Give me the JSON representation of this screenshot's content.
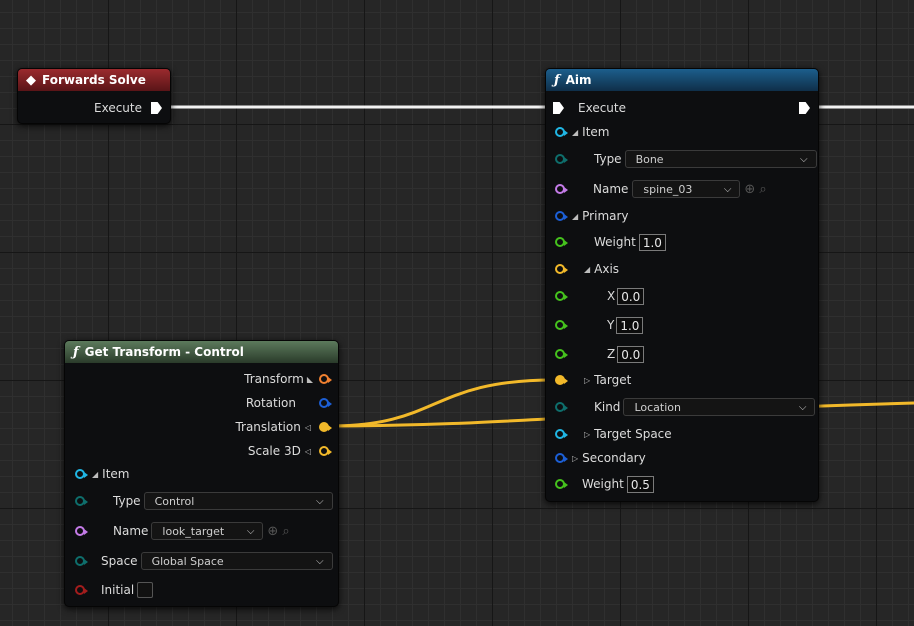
{
  "colors": {
    "exec": "#ffffff",
    "struct_cyan": "#20b6e4",
    "enum_teal": "#0e6e6c",
    "name_purple": "#c47be8",
    "struct_blue": "#1c5fd6",
    "float_green": "#45c21d",
    "vector_gold": "#f2b92a",
    "transform_orange": "#f08030",
    "bool_red": "#a31d1d",
    "wire_gold": "#f2b92a"
  },
  "forwards_solve": {
    "title": "Forwards Solve",
    "icon": "event-diamond-icon",
    "execute_label": "Execute"
  },
  "aim": {
    "title": "Aim",
    "icon": "function-icon",
    "execute_label": "Execute",
    "item_label": "Item",
    "type_label": "Type",
    "type_value": "Bone",
    "name_label": "Name",
    "name_value": "spine_03",
    "primary_label": "Primary",
    "weight_label": "Weight",
    "weight_value": "1.0",
    "axis_label": "Axis",
    "x_label": "X",
    "x_value": "0.0",
    "y_label": "Y",
    "y_value": "1.0",
    "z_label": "Z",
    "z_value": "0.0",
    "target_label": "Target",
    "kind_label": "Kind",
    "kind_value": "Location",
    "target_space_label": "Target Space",
    "secondary_label": "Secondary",
    "weight2_label": "Weight",
    "weight2_value": "0.5"
  },
  "get_transform": {
    "title": "Get Transform - Control",
    "icon": "function-icon",
    "transform_label": "Transform",
    "rotation_label": "Rotation",
    "translation_label": "Translation",
    "scale_label": "Scale 3D",
    "item_label": "Item",
    "type_label": "Type",
    "type_value": "Control",
    "name_label": "Name",
    "name_value": "look_target",
    "space_label": "Space",
    "space_value": "Global Space",
    "initial_label": "Initial",
    "initial_checked": false
  }
}
